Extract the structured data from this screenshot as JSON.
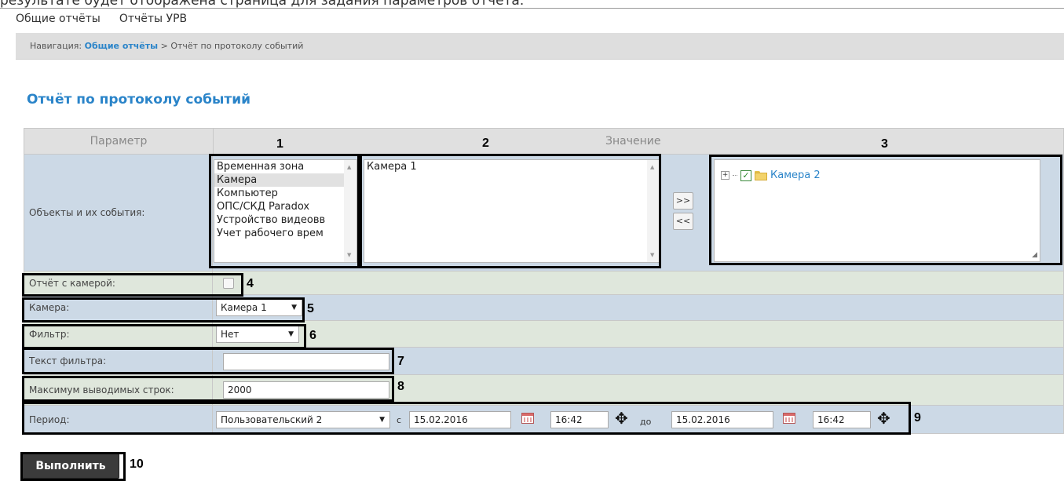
{
  "top_clip_text": "результате будет отображена страница для задания параметров отчёта.",
  "menu": {
    "items": [
      "Общие отчёты",
      "Отчёты УРВ"
    ]
  },
  "breadcrumb": {
    "prefix": "Навигация:",
    "link": "Общие отчёты",
    "separator": ">",
    "current": "Отчёт по протоколу событий"
  },
  "page_title": "Отчёт по протоколу событий",
  "table": {
    "header_param": "Параметр",
    "header_value": "Значение",
    "objects": {
      "label": "Объекты и их события:",
      "types": [
        "Временная зона",
        "Камера",
        "Компьютер",
        "ОПС/СКД Paradox",
        "Устройство видеовв",
        "Учет рабочего врем"
      ],
      "selected_type": "Камера",
      "instances": [
        "Камера 1"
      ],
      "move_right": ">>",
      "move_left": "<<",
      "tree_node": "Камера 2",
      "tree_checked": true
    },
    "with_camera": {
      "label": "Отчёт с камерой:",
      "checked": false
    },
    "camera": {
      "label": "Камера:",
      "value": "Камера 1"
    },
    "filter": {
      "label": "Фильтр:",
      "value": "Нет"
    },
    "filter_text": {
      "label": "Текст фильтра:",
      "value": ""
    },
    "max_rows": {
      "label": "Максимум выводимых строк:",
      "value": "2000"
    },
    "period": {
      "label": "Период:",
      "preset": "Пользовательский 2",
      "from_label": "с",
      "from_date": "15.02.2016",
      "from_time": "16:42",
      "to_label": "до",
      "to_date": "15.02.2016",
      "to_time": "16:42"
    }
  },
  "run_button": "Выполнить",
  "annotations": [
    "1",
    "2",
    "3",
    "4",
    "5",
    "6",
    "7",
    "8",
    "9",
    "10"
  ],
  "colors": {
    "accent": "#2a84c9",
    "row_blue": "#ccd9e6",
    "row_green": "#dfe7dc",
    "run_bg": "#3b3b3b"
  },
  "icons": [
    "expand-icon",
    "checkbox-icon",
    "folder-icon",
    "calendar-icon",
    "time-adjust-icon",
    "dropdown-arrow-icon",
    "resize-grip-icon"
  ]
}
